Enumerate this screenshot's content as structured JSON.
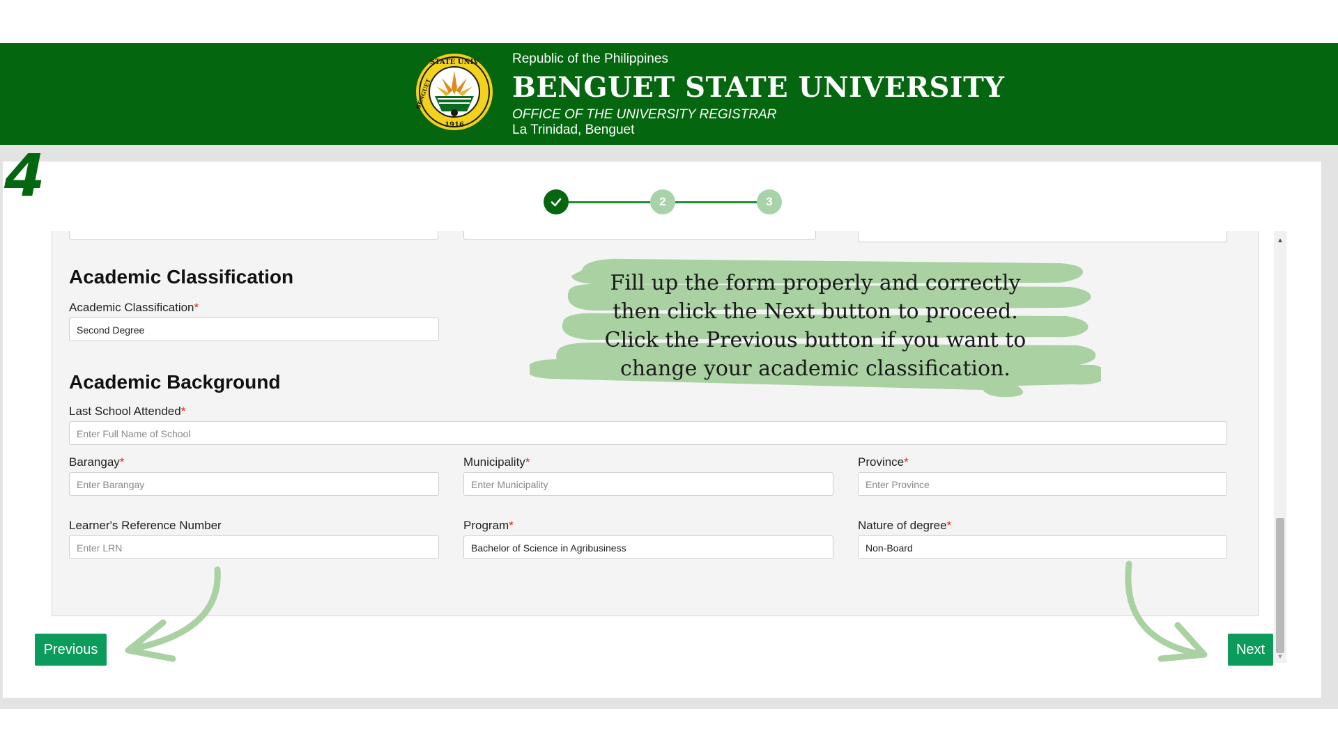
{
  "header": {
    "republic": "Republic of the Philippines",
    "university": "BENGUET STATE UNIVERSITY",
    "office": "OFFICE OF THE UNIVERSITY REGISTRAR",
    "location": "La Trinidad, Benguet",
    "seal": {
      "top_text": "STATE UNIV",
      "side_text": "BENGUET",
      "year": "1916"
    }
  },
  "step_badge": "4",
  "stepper": {
    "steps": [
      {
        "label": "",
        "state": "complete"
      },
      {
        "label": "2",
        "state": "upcoming"
      },
      {
        "label": "3",
        "state": "upcoming"
      }
    ]
  },
  "academic_classification": {
    "section_title": "Academic Classification",
    "field_label": "Academic Classification",
    "value": "Second Degree"
  },
  "academic_background": {
    "section_title": "Academic Background",
    "last_school": {
      "label": "Last School Attended",
      "placeholder": "Enter Full Name of School"
    },
    "barangay": {
      "label": "Barangay",
      "placeholder": "Enter Barangay"
    },
    "municipality": {
      "label": "Municipality",
      "placeholder": "Enter Municipality"
    },
    "province": {
      "label": "Province",
      "placeholder": "Enter Province"
    },
    "lrn": {
      "label": "Learner's Reference Number",
      "placeholder": "Enter LRN"
    },
    "program": {
      "label": "Program",
      "value": "Bachelor of Science in Agribusiness"
    },
    "nature_of_degree": {
      "label": "Nature of degree",
      "value": "Non-Board"
    }
  },
  "required_marker": "*",
  "buttons": {
    "previous": "Previous",
    "next": "Next"
  },
  "annotation": {
    "lines": [
      "Fill up the form properly and correctly",
      "then click the Next button to proceed.",
      "Click the Previous button if you want to",
      "change your academic classification."
    ]
  },
  "colors": {
    "header_green": "#04660f",
    "button_green": "#0b9c5c",
    "annotation_green": "#a9d1a2",
    "required_red": "#e02020"
  }
}
